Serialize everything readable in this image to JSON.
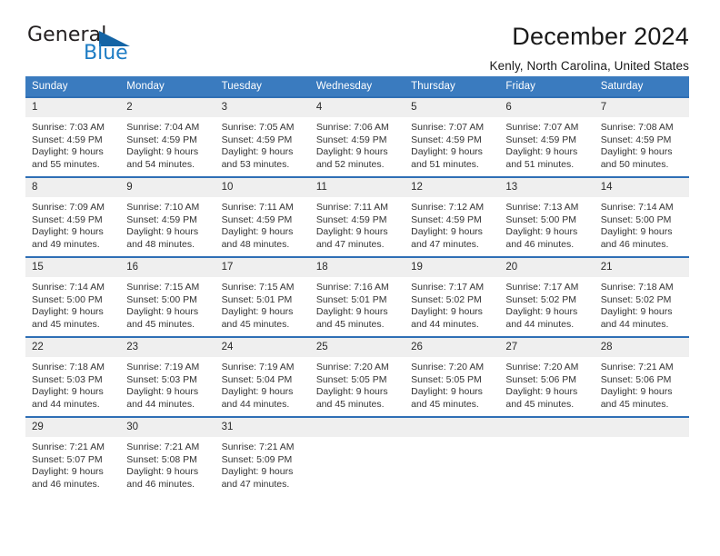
{
  "brand": {
    "name_part1": "General",
    "name_part2": "Blue"
  },
  "header": {
    "title": "December 2024",
    "location": "Kenly, North Carolina, United States"
  },
  "colors": {
    "header_blue": "#3a7bbf",
    "row_border_blue": "#2f6fb5",
    "daynum_band": "#efefef",
    "logo_blue": "#1464a5",
    "logo_text_blue": "#1d7cc4"
  },
  "weekday_headers": [
    "Sunday",
    "Monday",
    "Tuesday",
    "Wednesday",
    "Thursday",
    "Friday",
    "Saturday"
  ],
  "labels": {
    "sunrise_prefix": "Sunrise:",
    "sunset_prefix": "Sunset:",
    "daylight_prefix": "Daylight:"
  },
  "weeks": [
    [
      {
        "day": "1",
        "sunrise": "Sunrise: 7:03 AM",
        "sunset": "Sunset: 4:59 PM",
        "daylight_line1": "Daylight: 9 hours",
        "daylight_line2": "and 55 minutes."
      },
      {
        "day": "2",
        "sunrise": "Sunrise: 7:04 AM",
        "sunset": "Sunset: 4:59 PM",
        "daylight_line1": "Daylight: 9 hours",
        "daylight_line2": "and 54 minutes."
      },
      {
        "day": "3",
        "sunrise": "Sunrise: 7:05 AM",
        "sunset": "Sunset: 4:59 PM",
        "daylight_line1": "Daylight: 9 hours",
        "daylight_line2": "and 53 minutes."
      },
      {
        "day": "4",
        "sunrise": "Sunrise: 7:06 AM",
        "sunset": "Sunset: 4:59 PM",
        "daylight_line1": "Daylight: 9 hours",
        "daylight_line2": "and 52 minutes."
      },
      {
        "day": "5",
        "sunrise": "Sunrise: 7:07 AM",
        "sunset": "Sunset: 4:59 PM",
        "daylight_line1": "Daylight: 9 hours",
        "daylight_line2": "and 51 minutes."
      },
      {
        "day": "6",
        "sunrise": "Sunrise: 7:07 AM",
        "sunset": "Sunset: 4:59 PM",
        "daylight_line1": "Daylight: 9 hours",
        "daylight_line2": "and 51 minutes."
      },
      {
        "day": "7",
        "sunrise": "Sunrise: 7:08 AM",
        "sunset": "Sunset: 4:59 PM",
        "daylight_line1": "Daylight: 9 hours",
        "daylight_line2": "and 50 minutes."
      }
    ],
    [
      {
        "day": "8",
        "sunrise": "Sunrise: 7:09 AM",
        "sunset": "Sunset: 4:59 PM",
        "daylight_line1": "Daylight: 9 hours",
        "daylight_line2": "and 49 minutes."
      },
      {
        "day": "9",
        "sunrise": "Sunrise: 7:10 AM",
        "sunset": "Sunset: 4:59 PM",
        "daylight_line1": "Daylight: 9 hours",
        "daylight_line2": "and 48 minutes."
      },
      {
        "day": "10",
        "sunrise": "Sunrise: 7:11 AM",
        "sunset": "Sunset: 4:59 PM",
        "daylight_line1": "Daylight: 9 hours",
        "daylight_line2": "and 48 minutes."
      },
      {
        "day": "11",
        "sunrise": "Sunrise: 7:11 AM",
        "sunset": "Sunset: 4:59 PM",
        "daylight_line1": "Daylight: 9 hours",
        "daylight_line2": "and 47 minutes."
      },
      {
        "day": "12",
        "sunrise": "Sunrise: 7:12 AM",
        "sunset": "Sunset: 4:59 PM",
        "daylight_line1": "Daylight: 9 hours",
        "daylight_line2": "and 47 minutes."
      },
      {
        "day": "13",
        "sunrise": "Sunrise: 7:13 AM",
        "sunset": "Sunset: 5:00 PM",
        "daylight_line1": "Daylight: 9 hours",
        "daylight_line2": "and 46 minutes."
      },
      {
        "day": "14",
        "sunrise": "Sunrise: 7:14 AM",
        "sunset": "Sunset: 5:00 PM",
        "daylight_line1": "Daylight: 9 hours",
        "daylight_line2": "and 46 minutes."
      }
    ],
    [
      {
        "day": "15",
        "sunrise": "Sunrise: 7:14 AM",
        "sunset": "Sunset: 5:00 PM",
        "daylight_line1": "Daylight: 9 hours",
        "daylight_line2": "and 45 minutes."
      },
      {
        "day": "16",
        "sunrise": "Sunrise: 7:15 AM",
        "sunset": "Sunset: 5:00 PM",
        "daylight_line1": "Daylight: 9 hours",
        "daylight_line2": "and 45 minutes."
      },
      {
        "day": "17",
        "sunrise": "Sunrise: 7:15 AM",
        "sunset": "Sunset: 5:01 PM",
        "daylight_line1": "Daylight: 9 hours",
        "daylight_line2": "and 45 minutes."
      },
      {
        "day": "18",
        "sunrise": "Sunrise: 7:16 AM",
        "sunset": "Sunset: 5:01 PM",
        "daylight_line1": "Daylight: 9 hours",
        "daylight_line2": "and 45 minutes."
      },
      {
        "day": "19",
        "sunrise": "Sunrise: 7:17 AM",
        "sunset": "Sunset: 5:02 PM",
        "daylight_line1": "Daylight: 9 hours",
        "daylight_line2": "and 44 minutes."
      },
      {
        "day": "20",
        "sunrise": "Sunrise: 7:17 AM",
        "sunset": "Sunset: 5:02 PM",
        "daylight_line1": "Daylight: 9 hours",
        "daylight_line2": "and 44 minutes."
      },
      {
        "day": "21",
        "sunrise": "Sunrise: 7:18 AM",
        "sunset": "Sunset: 5:02 PM",
        "daylight_line1": "Daylight: 9 hours",
        "daylight_line2": "and 44 minutes."
      }
    ],
    [
      {
        "day": "22",
        "sunrise": "Sunrise: 7:18 AM",
        "sunset": "Sunset: 5:03 PM",
        "daylight_line1": "Daylight: 9 hours",
        "daylight_line2": "and 44 minutes."
      },
      {
        "day": "23",
        "sunrise": "Sunrise: 7:19 AM",
        "sunset": "Sunset: 5:03 PM",
        "daylight_line1": "Daylight: 9 hours",
        "daylight_line2": "and 44 minutes."
      },
      {
        "day": "24",
        "sunrise": "Sunrise: 7:19 AM",
        "sunset": "Sunset: 5:04 PM",
        "daylight_line1": "Daylight: 9 hours",
        "daylight_line2": "and 44 minutes."
      },
      {
        "day": "25",
        "sunrise": "Sunrise: 7:20 AM",
        "sunset": "Sunset: 5:05 PM",
        "daylight_line1": "Daylight: 9 hours",
        "daylight_line2": "and 45 minutes."
      },
      {
        "day": "26",
        "sunrise": "Sunrise: 7:20 AM",
        "sunset": "Sunset: 5:05 PM",
        "daylight_line1": "Daylight: 9 hours",
        "daylight_line2": "and 45 minutes."
      },
      {
        "day": "27",
        "sunrise": "Sunrise: 7:20 AM",
        "sunset": "Sunset: 5:06 PM",
        "daylight_line1": "Daylight: 9 hours",
        "daylight_line2": "and 45 minutes."
      },
      {
        "day": "28",
        "sunrise": "Sunrise: 7:21 AM",
        "sunset": "Sunset: 5:06 PM",
        "daylight_line1": "Daylight: 9 hours",
        "daylight_line2": "and 45 minutes."
      }
    ],
    [
      {
        "day": "29",
        "sunrise": "Sunrise: 7:21 AM",
        "sunset": "Sunset: 5:07 PM",
        "daylight_line1": "Daylight: 9 hours",
        "daylight_line2": "and 46 minutes."
      },
      {
        "day": "30",
        "sunrise": "Sunrise: 7:21 AM",
        "sunset": "Sunset: 5:08 PM",
        "daylight_line1": "Daylight: 9 hours",
        "daylight_line2": "and 46 minutes."
      },
      {
        "day": "31",
        "sunrise": "Sunrise: 7:21 AM",
        "sunset": "Sunset: 5:09 PM",
        "daylight_line1": "Daylight: 9 hours",
        "daylight_line2": "and 47 minutes."
      },
      {
        "day": "",
        "sunrise": "",
        "sunset": "",
        "daylight_line1": "",
        "daylight_line2": ""
      },
      {
        "day": "",
        "sunrise": "",
        "sunset": "",
        "daylight_line1": "",
        "daylight_line2": ""
      },
      {
        "day": "",
        "sunrise": "",
        "sunset": "",
        "daylight_line1": "",
        "daylight_line2": ""
      },
      {
        "day": "",
        "sunrise": "",
        "sunset": "",
        "daylight_line1": "",
        "daylight_line2": ""
      }
    ]
  ]
}
